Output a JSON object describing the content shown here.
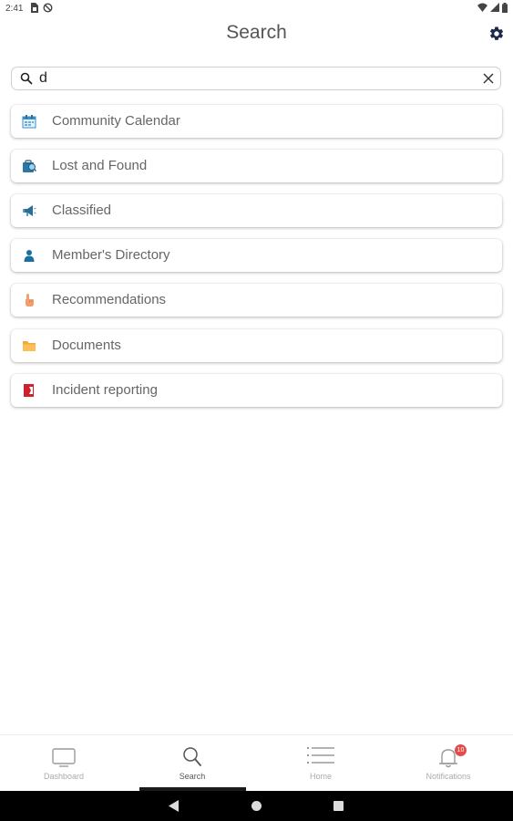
{
  "status_bar": {
    "time": "2:41",
    "icons_left": [
      "sim-card-icon",
      "no-sync-icon"
    ],
    "icons_right": [
      "wifi-icon",
      "signal-icon",
      "battery-icon"
    ]
  },
  "header": {
    "title": "Search",
    "settings_icon": "gear-icon"
  },
  "search": {
    "value": "d",
    "placeholder": "",
    "search_icon": "search-icon",
    "clear_icon": "close-icon"
  },
  "results": [
    {
      "label": "Community Calendar",
      "icon": "calendar-icon",
      "color": "#3a8fc9"
    },
    {
      "label": "Lost and Found",
      "icon": "lost-and-found-icon",
      "color": "#2a7aa8"
    },
    {
      "label": "Classified",
      "icon": "megaphone-icon",
      "color": "#2e6e96"
    },
    {
      "label": "Member's Directory",
      "icon": "person-icon",
      "color": "#1b6fa3"
    },
    {
      "label": "Recommendations",
      "icon": "pointing-hand-icon",
      "color": "#f0a070"
    },
    {
      "label": "Documents",
      "icon": "folder-icon",
      "color": "#f5a83a"
    },
    {
      "label": "Incident reporting",
      "icon": "incident-icon",
      "color": "#d0202a"
    }
  ],
  "bottom_nav": {
    "items": [
      {
        "label": "Dashboard",
        "icon": "monitor-icon"
      },
      {
        "label": "Search",
        "icon": "search-icon"
      },
      {
        "label": "Home",
        "icon": "list-icon"
      },
      {
        "label": "Notifications",
        "icon": "bell-icon",
        "badge": "10"
      }
    ],
    "active": "Search"
  },
  "android_nav": {
    "icons": [
      "back-icon",
      "home-icon",
      "recent-apps-icon"
    ]
  }
}
